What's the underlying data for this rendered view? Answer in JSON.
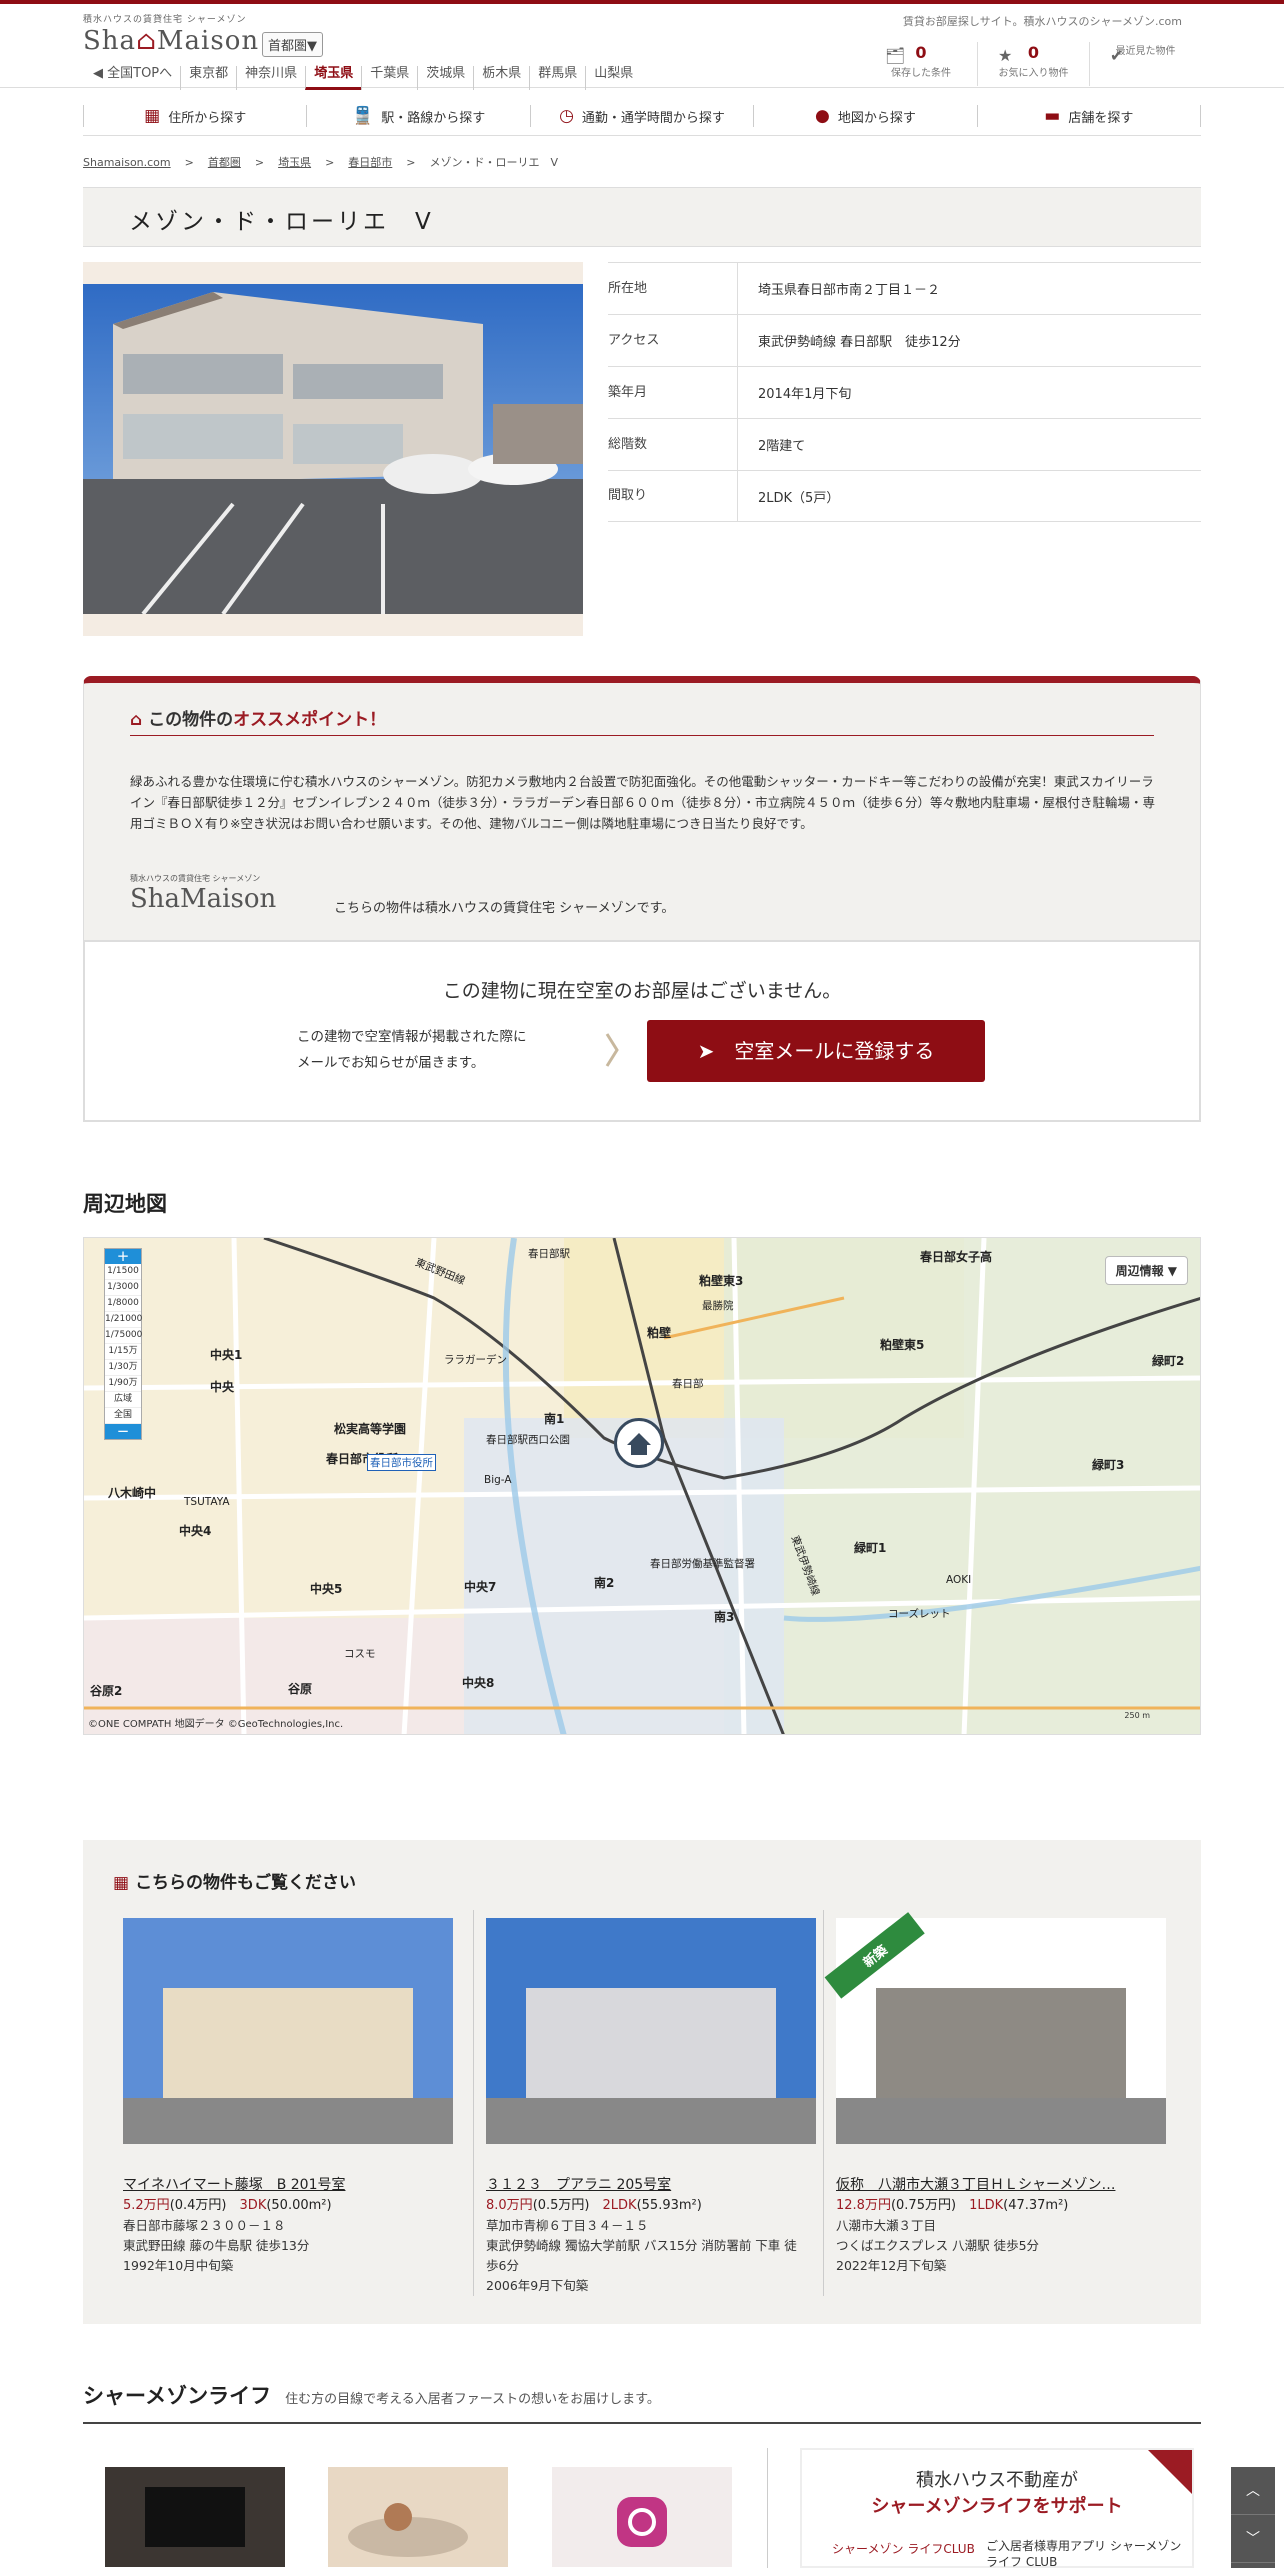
{
  "header": {
    "brand_small": "積水ハウスの賃貸住宅 シャーメゾン",
    "logo_a": "Sha",
    "logo_m": "⌂",
    "logo_b": "Maison",
    "area_select": "首都圏▼",
    "tagline": "賃貸お部屋探しサイト。積水ハウスのシャーメゾン.com",
    "prefectures": [
      "◀ 全国TOPへ",
      "東京都",
      "神奈川県",
      "埼玉県",
      "千葉県",
      "茨城県",
      "栃木県",
      "群馬県",
      "山梨県"
    ],
    "active_prefecture": "埼玉県",
    "icons": [
      {
        "name": "saved-conditions-icon",
        "glyph": "🗂",
        "count": "0",
        "label": "保存した条件"
      },
      {
        "name": "favorites-icon",
        "glyph": "★",
        "count": "0",
        "label": "お気に入り物件"
      },
      {
        "name": "recently-viewed-icon",
        "glyph": "✔",
        "count": "",
        "label": "最近見た物件"
      }
    ]
  },
  "search_nav": [
    {
      "icon": "building-icon",
      "glyph": "▦",
      "label": "住所から探す"
    },
    {
      "icon": "train-icon",
      "glyph": "🚆",
      "label": "駅・路線から探す"
    },
    {
      "icon": "clock-icon",
      "glyph": "◷",
      "label": "通勤・通学時間から探す"
    },
    {
      "icon": "map-pin-icon",
      "glyph": "●",
      "label": "地図から探す"
    },
    {
      "icon": "shop-icon",
      "glyph": "▬",
      "label": "店舗を探す"
    }
  ],
  "breadcrumb": [
    "Shamaison.com",
    ">",
    "首都圏",
    ">",
    "埼玉県",
    ">",
    "春日部市",
    ">",
    "メゾン・ド・ローリエ　V"
  ],
  "property": {
    "title": "メゾン・ド・ローリエ　V",
    "specs": [
      {
        "key": "所在地",
        "value": "埼玉県春日部市南２丁目１－２"
      },
      {
        "key": "アクセス",
        "value": "東武伊勢崎線 春日部駅　徒歩12分"
      },
      {
        "key": "築年月",
        "value": "2014年1月下旬"
      },
      {
        "key": "総階数",
        "value": "2階建て"
      },
      {
        "key": "間取り",
        "value": "2LDK（5戸）"
      }
    ]
  },
  "recommend": {
    "heading_prefix": "この物件の",
    "heading_em": "オススメポイント！",
    "text": "緑あふれる豊かな住環境に佇む積水ハウスのシャーメゾン。防犯カメラ敷地内２台設置で防犯面強化。その他電動シャッター・カードキー等こだわりの設備が充実！東武スカイリーライン『春日部駅徒歩１２分』セブンイレブン２４０ｍ（徒歩３分）・ララガーデン春日部６００ｍ（徒歩８分）・市立病院４５０ｍ（徒歩６分）等々敷地内駐車場・屋根付き駐輪場・専用ゴミＢＯＸ有り※空き状況はお問い合わせ願います。その他、建物バルコニー側は隣地駐車場につき日当たり良好です。",
    "logo_small": "積水ハウスの賃貸住宅 シャーメゾン",
    "logo": "ShaMaison",
    "logo_note": "こちらの物件は積水ハウスの賃貸住宅 シャーメゾンです。"
  },
  "vacancy": {
    "message": "この建物に現在空室のお部屋はございません。",
    "note_line1": "この建物で空室情報が掲載された際に",
    "note_line2": "メールでお知らせが届きます。",
    "button": "➤　空室メールに登録する"
  },
  "map": {
    "title": "周辺地図",
    "info_button": "周辺情報 ▼",
    "copyright": "©ONE COMPATH 地図データ ©GeoTechnologies,Inc.",
    "scale": "250 m",
    "zoom_levels": [
      "1/1500",
      "1/3000",
      "1/8000",
      "1/21000",
      "1/75000",
      "1/15万",
      "1/30万",
      "1/90万",
      "広域",
      "全国"
    ],
    "labels": {
      "kasukabe_higashi3": "粕壁東3",
      "kasukabe_higashi5": "粕壁東5",
      "kasukabe": "粕壁",
      "kasukabe_station": "春日部",
      "minami1": "南1",
      "minami2": "南2",
      "minami3": "南3",
      "chuo": "中央",
      "chuo1": "中央1",
      "chuo4": "中央4",
      "chuo5": "中央5",
      "chuo7": "中央7",
      "chuo8": "中央8",
      "midoricho1": "緑町1",
      "midoricho2": "緑町2",
      "midoricho3": "緑町3",
      "yagisaki": "八木崎中",
      "tanihara2": "谷原2",
      "tanihara": "谷原",
      "city_hall": "春日部市役所",
      "school": "松実高等学園",
      "kasukabe_kasaijo": "春日部労働基準監督署",
      "lalagarden": "ララガーデン",
      "kasukabe_shiyakusho_station": "春日部市役所",
      "tobu_noda": "東武野田線",
      "tobu_isesaki": "東武伊勢崎線",
      "kasukabe_station_label": "春日部駅",
      "temple": "最勝院",
      "minami1_park": "春日部駅西口公園",
      "coolbiz": "コーズレット",
      "aoki": "AOKI",
      "bigA": "Big-A",
      "tsutaya": "TSUTAYA",
      "cosmo": "コスモ",
      "kasukabe_jo": "春日部女子高"
    }
  },
  "related": {
    "title": "こちらの物件もご覧ください",
    "cards": [
      {
        "name": "マイネハイマート藤塚　B 201号室",
        "rent": "5.2万円",
        "fee": "(0.4万円)",
        "layout": "3DK",
        "area": "(50.00m²)",
        "addr": "春日部市藤塚２３００－１８",
        "access": "東武野田線 藤の牛島駅 徒歩13分",
        "built": "1992年10月中旬築",
        "badge": ""
      },
      {
        "name": "３１２３　プアラニ 205号室",
        "rent": "8.0万円",
        "fee": "(0.5万円)",
        "layout": "2LDK",
        "area": "(55.93m²)",
        "addr": "草加市青柳６丁目３４－１５",
        "access": "東武伊勢崎線 獨協大学前駅 バス15分 消防署前 下車 徒歩6分",
        "built": "2006年9月下旬築",
        "badge": ""
      },
      {
        "name": "仮称　八潮市大瀬３丁目ＨＬシャーメゾン…",
        "rent": "12.8万円",
        "fee": "(0.75万円)",
        "layout": "1LDK",
        "area": "(47.37m²)",
        "addr": "八潮市大瀬３丁目",
        "access": "つくばエクスプレス 八潮駅 徒歩5分",
        "built": "2022年12月下旬築",
        "badge": "新築"
      }
    ]
  },
  "life": {
    "title": "シャーメゾンライフ",
    "subtitle": "住む方の目線で考える入居者ファーストの想いをお届けします。",
    "support_line1": "積水ハウス不動産が",
    "support_line2": "シャーメゾンライフをサポート",
    "support_logo": "シャーメゾン ライフCLUB",
    "support_note": "ご入居者様専用アプリ シャーメゾンライフ CLUB",
    "to_top_a": "︿",
    "to_top_b": "﹀"
  }
}
